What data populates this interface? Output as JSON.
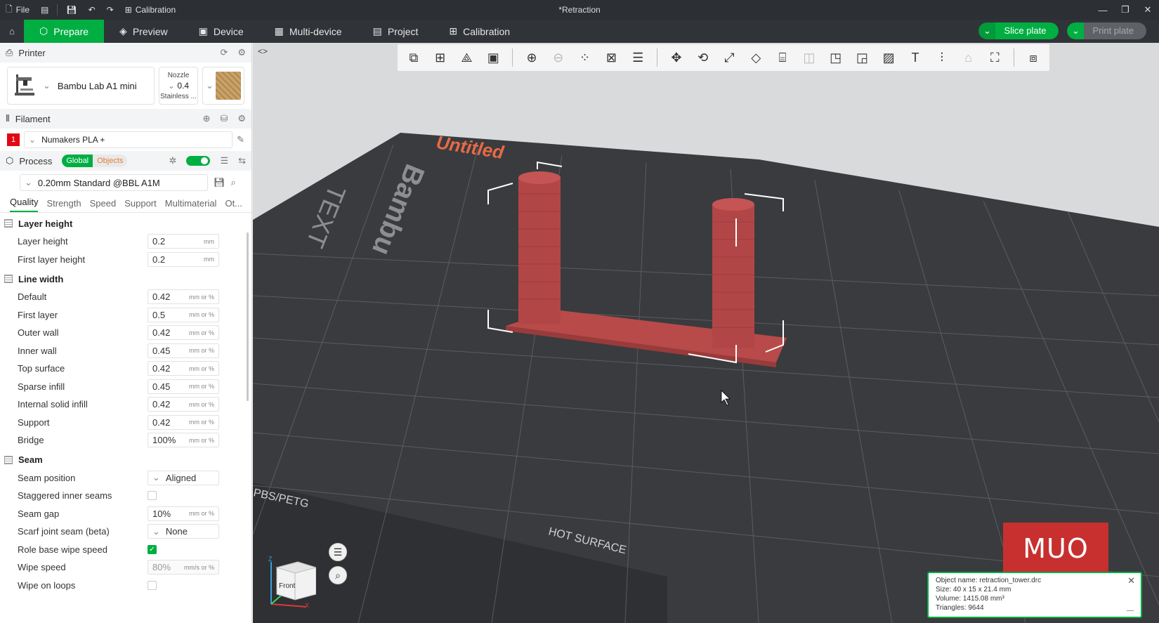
{
  "titlebar": {
    "file_label": "File",
    "calibration_label": "Calibration",
    "document_title": "*Retraction"
  },
  "nav": {
    "tabs": [
      {
        "label": "Prepare",
        "icon": "cube-icon",
        "active": true
      },
      {
        "label": "Preview",
        "icon": "layers-icon"
      },
      {
        "label": "Device",
        "icon": "device-icon"
      },
      {
        "label": "Multi-device",
        "icon": "multi-device-icon"
      },
      {
        "label": "Project",
        "icon": "project-icon"
      },
      {
        "label": "Calibration",
        "icon": "calibration-icon"
      }
    ],
    "slice_label": "Slice plate",
    "print_label": "Print plate",
    "accent": "#00ae42"
  },
  "printer": {
    "section_label": "Printer",
    "model": "Bambu Lab A1 mini",
    "nozzle_label": "Nozzle",
    "nozzle_value": "0.4",
    "nozzle_type": "Stainless ..."
  },
  "filament": {
    "section_label": "Filament",
    "slot": "1",
    "slot_color": "#e30613",
    "name": "Numakers PLA +"
  },
  "process": {
    "section_label": "Process",
    "global_label": "Global",
    "objects_label": "Objects",
    "preset": "0.20mm Standard @BBL A1M",
    "tabs": [
      "Quality",
      "Strength",
      "Speed",
      "Support",
      "Multimaterial",
      "Ot..."
    ]
  },
  "layer_height": {
    "title": "Layer height",
    "rows": [
      {
        "label": "Layer height",
        "value": "0.2",
        "unit": "mm"
      },
      {
        "label": "First layer height",
        "value": "0.2",
        "unit": "mm"
      }
    ]
  },
  "line_width": {
    "title": "Line width",
    "rows": [
      {
        "label": "Default",
        "value": "0.42",
        "unit": "mm or %"
      },
      {
        "label": "First layer",
        "value": "0.5",
        "unit": "mm or %"
      },
      {
        "label": "Outer wall",
        "value": "0.42",
        "unit": "mm or %"
      },
      {
        "label": "Inner wall",
        "value": "0.45",
        "unit": "mm or %"
      },
      {
        "label": "Top surface",
        "value": "0.42",
        "unit": "mm or %"
      },
      {
        "label": "Sparse infill",
        "value": "0.45",
        "unit": "mm or %"
      },
      {
        "label": "Internal solid infill",
        "value": "0.42",
        "unit": "mm or %"
      },
      {
        "label": "Support",
        "value": "0.42",
        "unit": "mm or %"
      },
      {
        "label": "Bridge",
        "value": "100%",
        "unit": "mm or %"
      }
    ]
  },
  "seam": {
    "title": "Seam",
    "seam_position_label": "Seam position",
    "seam_position_value": "Aligned",
    "staggered_label": "Staggered inner seams",
    "seam_gap_label": "Seam gap",
    "seam_gap_value": "10%",
    "seam_gap_unit": "mm or %",
    "scarf_label": "Scarf joint seam (beta)",
    "scarf_value": "None",
    "role_wipe_label": "Role base wipe speed",
    "wipe_speed_label": "Wipe speed",
    "wipe_speed_value": "80%",
    "wipe_speed_unit": "mm/s or %",
    "wipe_loops_label": "Wipe on loops"
  },
  "viewport": {
    "plate_name": "Untitled",
    "bed_brand": "Bambu",
    "bed_text_1": "TEXT",
    "bed_text_2": "PBS/PETG",
    "bed_text_3": "HOT SURFACE",
    "cube_label": "Front",
    "axis_z": "Z",
    "axis_x": "X",
    "model_color": "#b94a4a"
  },
  "object_info": {
    "name": "Object name: retraction_tower.drc",
    "size": "Size: 40 x 15 x 21.4 mm",
    "volume": "Volume: 1415.08 mm³",
    "triangles": "Triangles: 9644"
  },
  "watermark": "MUO"
}
